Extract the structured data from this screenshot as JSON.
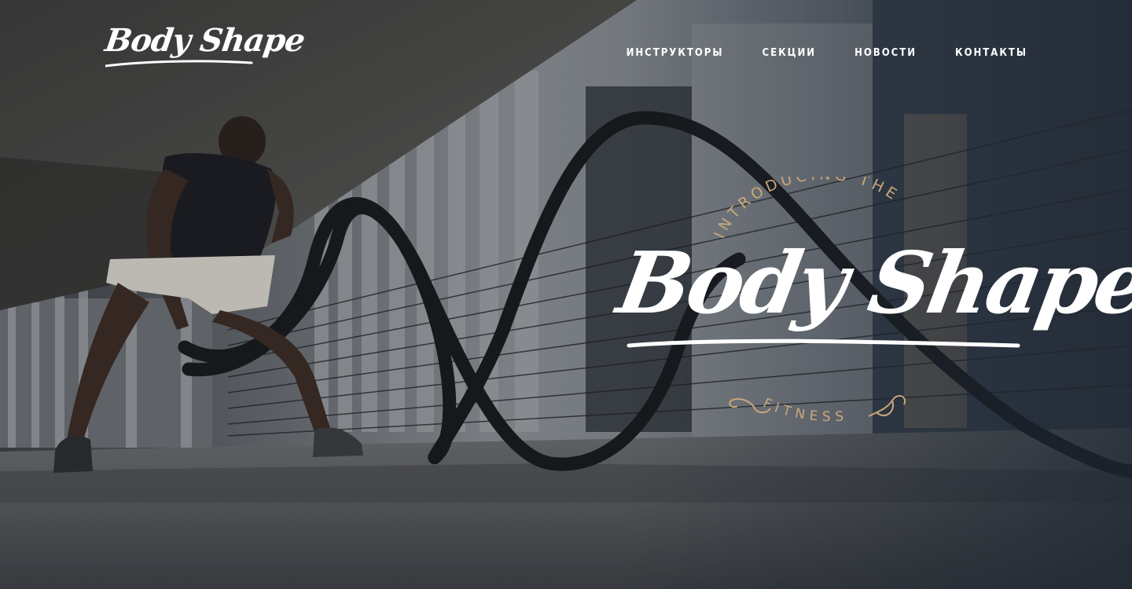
{
  "brand": {
    "logo_text": "Body Shape"
  },
  "nav": {
    "items": [
      {
        "label": "ИНСТРУКТОРЫ"
      },
      {
        "label": "СЕКЦИИ"
      },
      {
        "label": "НОВОСТИ"
      },
      {
        "label": "КОНТАКТЫ"
      }
    ]
  },
  "hero": {
    "intro_text": "INTRODUCING THE",
    "title": "Body Shape",
    "subtitle": "FITNESS",
    "accent_color": "#c9a77a",
    "text_color": "#ffffff"
  }
}
